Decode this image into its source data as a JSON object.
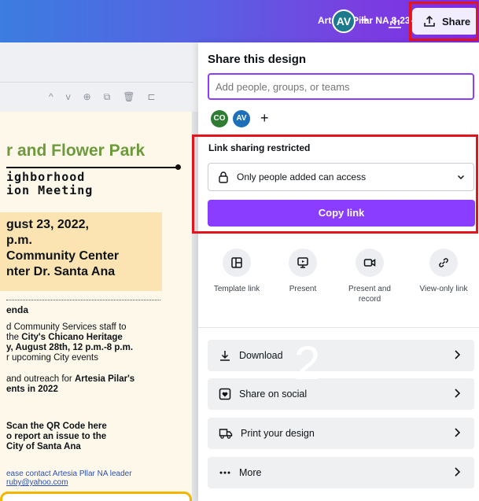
{
  "topbar": {
    "title": "Artesia Pilar NA 8-23-2022",
    "avatar_initials": "AV",
    "add_label": "+",
    "share_label": "Share"
  },
  "editor": {
    "page_buttons": [
      "^",
      "v",
      "⊕",
      "⧉",
      "🗑",
      "⊏"
    ],
    "doc": {
      "heading": "r and Flower Park",
      "subheading_1": "ighborhood",
      "subheading_2": "ion Meeting",
      "box_lines": [
        "gust 23, 2022,",
        "p.m.",
        "Community Center",
        "nter Dr. Santa Ana"
      ],
      "agenda": "enda",
      "para1_lines": [
        "d Community Services staff to",
        "the ",
        "City's Chicano Heritage",
        "y, August 28th, 12 p.m.-8 p.m.",
        "r upcoming City events"
      ],
      "para2_prefix": "and outreach for ",
      "para2_bold": "Artesia Pilar's",
      "para2_line2": "ents in 2022",
      "qr_lines": [
        "Scan the QR Code here",
        "o report an issue to the",
        "City of Santa Ana"
      ],
      "contact_lines": [
        "ease contact Artesia Pllar NA leader",
        "ruby@yahoo.com"
      ]
    }
  },
  "share_panel": {
    "title": "Share this design",
    "input_placeholder": "Add people, groups, or teams",
    "collaborators": [
      "CO",
      "AV"
    ],
    "add_label": "+",
    "link_sharing_label": "Link sharing restricted",
    "access_value": "Only people added can access",
    "copy_link_label": "Copy link",
    "options": [
      "Template link",
      "Present",
      "Present and record",
      "View-only link"
    ],
    "actions": [
      "Download",
      "Share on social",
      "Print your design",
      "More"
    ],
    "overlay_number": "2"
  },
  "colors": {
    "accent": "#8b3dff",
    "highlight": "#e4141c"
  }
}
